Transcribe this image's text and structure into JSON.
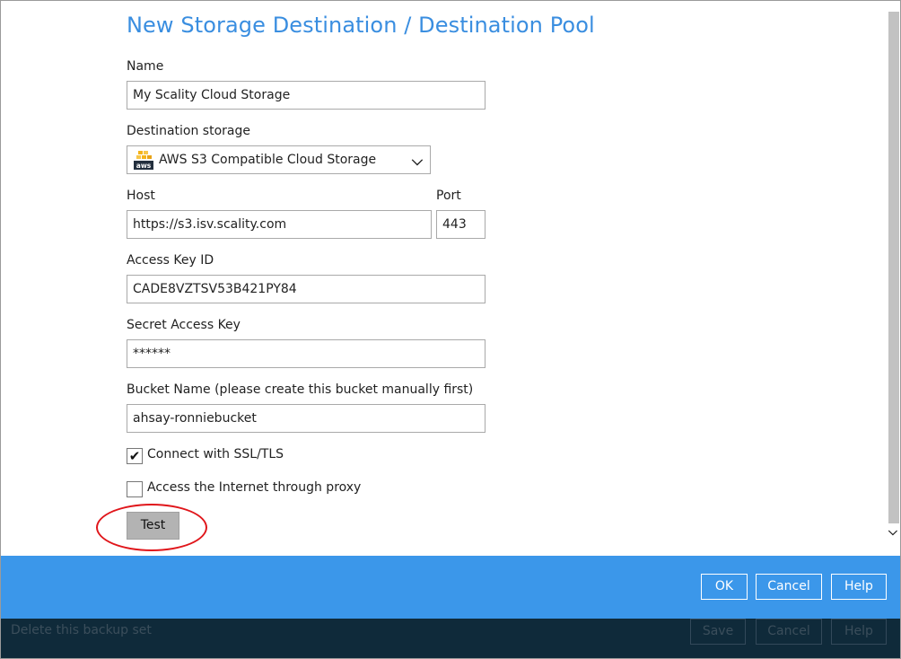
{
  "dialog": {
    "title": "New Storage Destination / Destination Pool",
    "name_label": "Name",
    "name_value": "My Scality Cloud Storage",
    "destination_label": "Destination storage",
    "destination_value": "AWS S3 Compatible Cloud Storage",
    "destination_icon": "aws-icon",
    "host_label": "Host",
    "host_value": "https://s3.isv.scality.com",
    "port_label": "Port",
    "port_value": "443",
    "access_key_label": "Access Key ID",
    "access_key_value": "CADE8VZTSV53B421PY84",
    "secret_key_label": "Secret Access Key",
    "secret_key_value": "******",
    "bucket_label": "Bucket Name (please create this bucket manually first)",
    "bucket_value": "ahsay-ronniebucket",
    "ssl_label": "Connect with SSL/TLS",
    "ssl_checked": true,
    "proxy_label": "Access the Internet through proxy",
    "proxy_checked": false,
    "test_label": "Test"
  },
  "footer": {
    "ok_label": "OK",
    "cancel_label": "Cancel",
    "help_label": "Help"
  },
  "background_bar": {
    "delete_text": "Delete this backup set",
    "save_label": "Save",
    "cancel_label": "Cancel",
    "help_label": "Help"
  },
  "colors": {
    "accent": "#3b97ea",
    "title": "#3a8ee0",
    "highlight_ring": "#e0161b"
  }
}
